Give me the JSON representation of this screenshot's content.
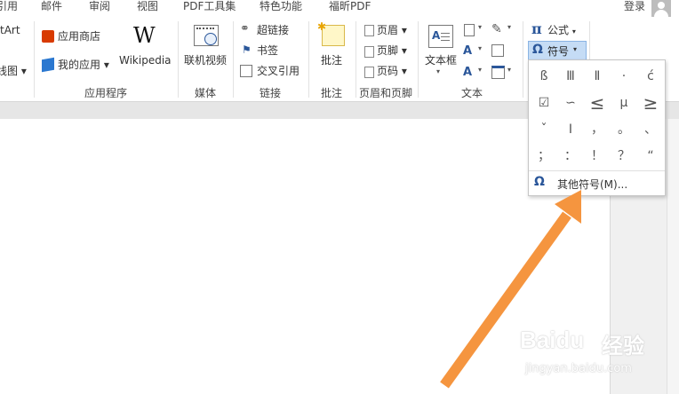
{
  "tabs": [
    "引用",
    "邮件",
    "审阅",
    "视图",
    "PDF工具集",
    "特色功能",
    "福昕PDF"
  ],
  "login": "登录",
  "ribbon": {
    "smartart": "tArt",
    "chart": "线图",
    "app_store": "应用商店",
    "my_apps": "我的应用",
    "wikipedia": "Wikipedia",
    "online_video": "联机视频",
    "hyperlink": "超链接",
    "bookmark": "书签",
    "cross_ref": "交叉引用",
    "comment": "批注",
    "header": "页眉",
    "footer": "页脚",
    "page_number": "页码",
    "textbox": "文本框",
    "formula": "公式",
    "symbol": "符号",
    "groups": {
      "apps": "应用程序",
      "media": "媒体",
      "links": "链接",
      "comments": "批注",
      "header_footer": "页眉和页脚",
      "text": "文本"
    }
  },
  "symbol_panel": {
    "symbols": [
      "ß",
      "Ⅲ",
      "Ⅱ",
      "·",
      "ć",
      "☑",
      "∽",
      "≤",
      "μ",
      "≥",
      "ˇ",
      "Ⅰ",
      "，",
      "。",
      "、",
      "；",
      "：",
      "！",
      "？",
      "“"
    ],
    "more": "其他符号(M)..."
  },
  "watermark": {
    "brand": "Baidu",
    "product": "经验",
    "url": "jingyan.baidu.com"
  },
  "colors": {
    "accent": "#2b579a",
    "arrow": "#f5953f",
    "app_store_red": "#d83b01",
    "my_apps_blue": "#2b78d0"
  }
}
